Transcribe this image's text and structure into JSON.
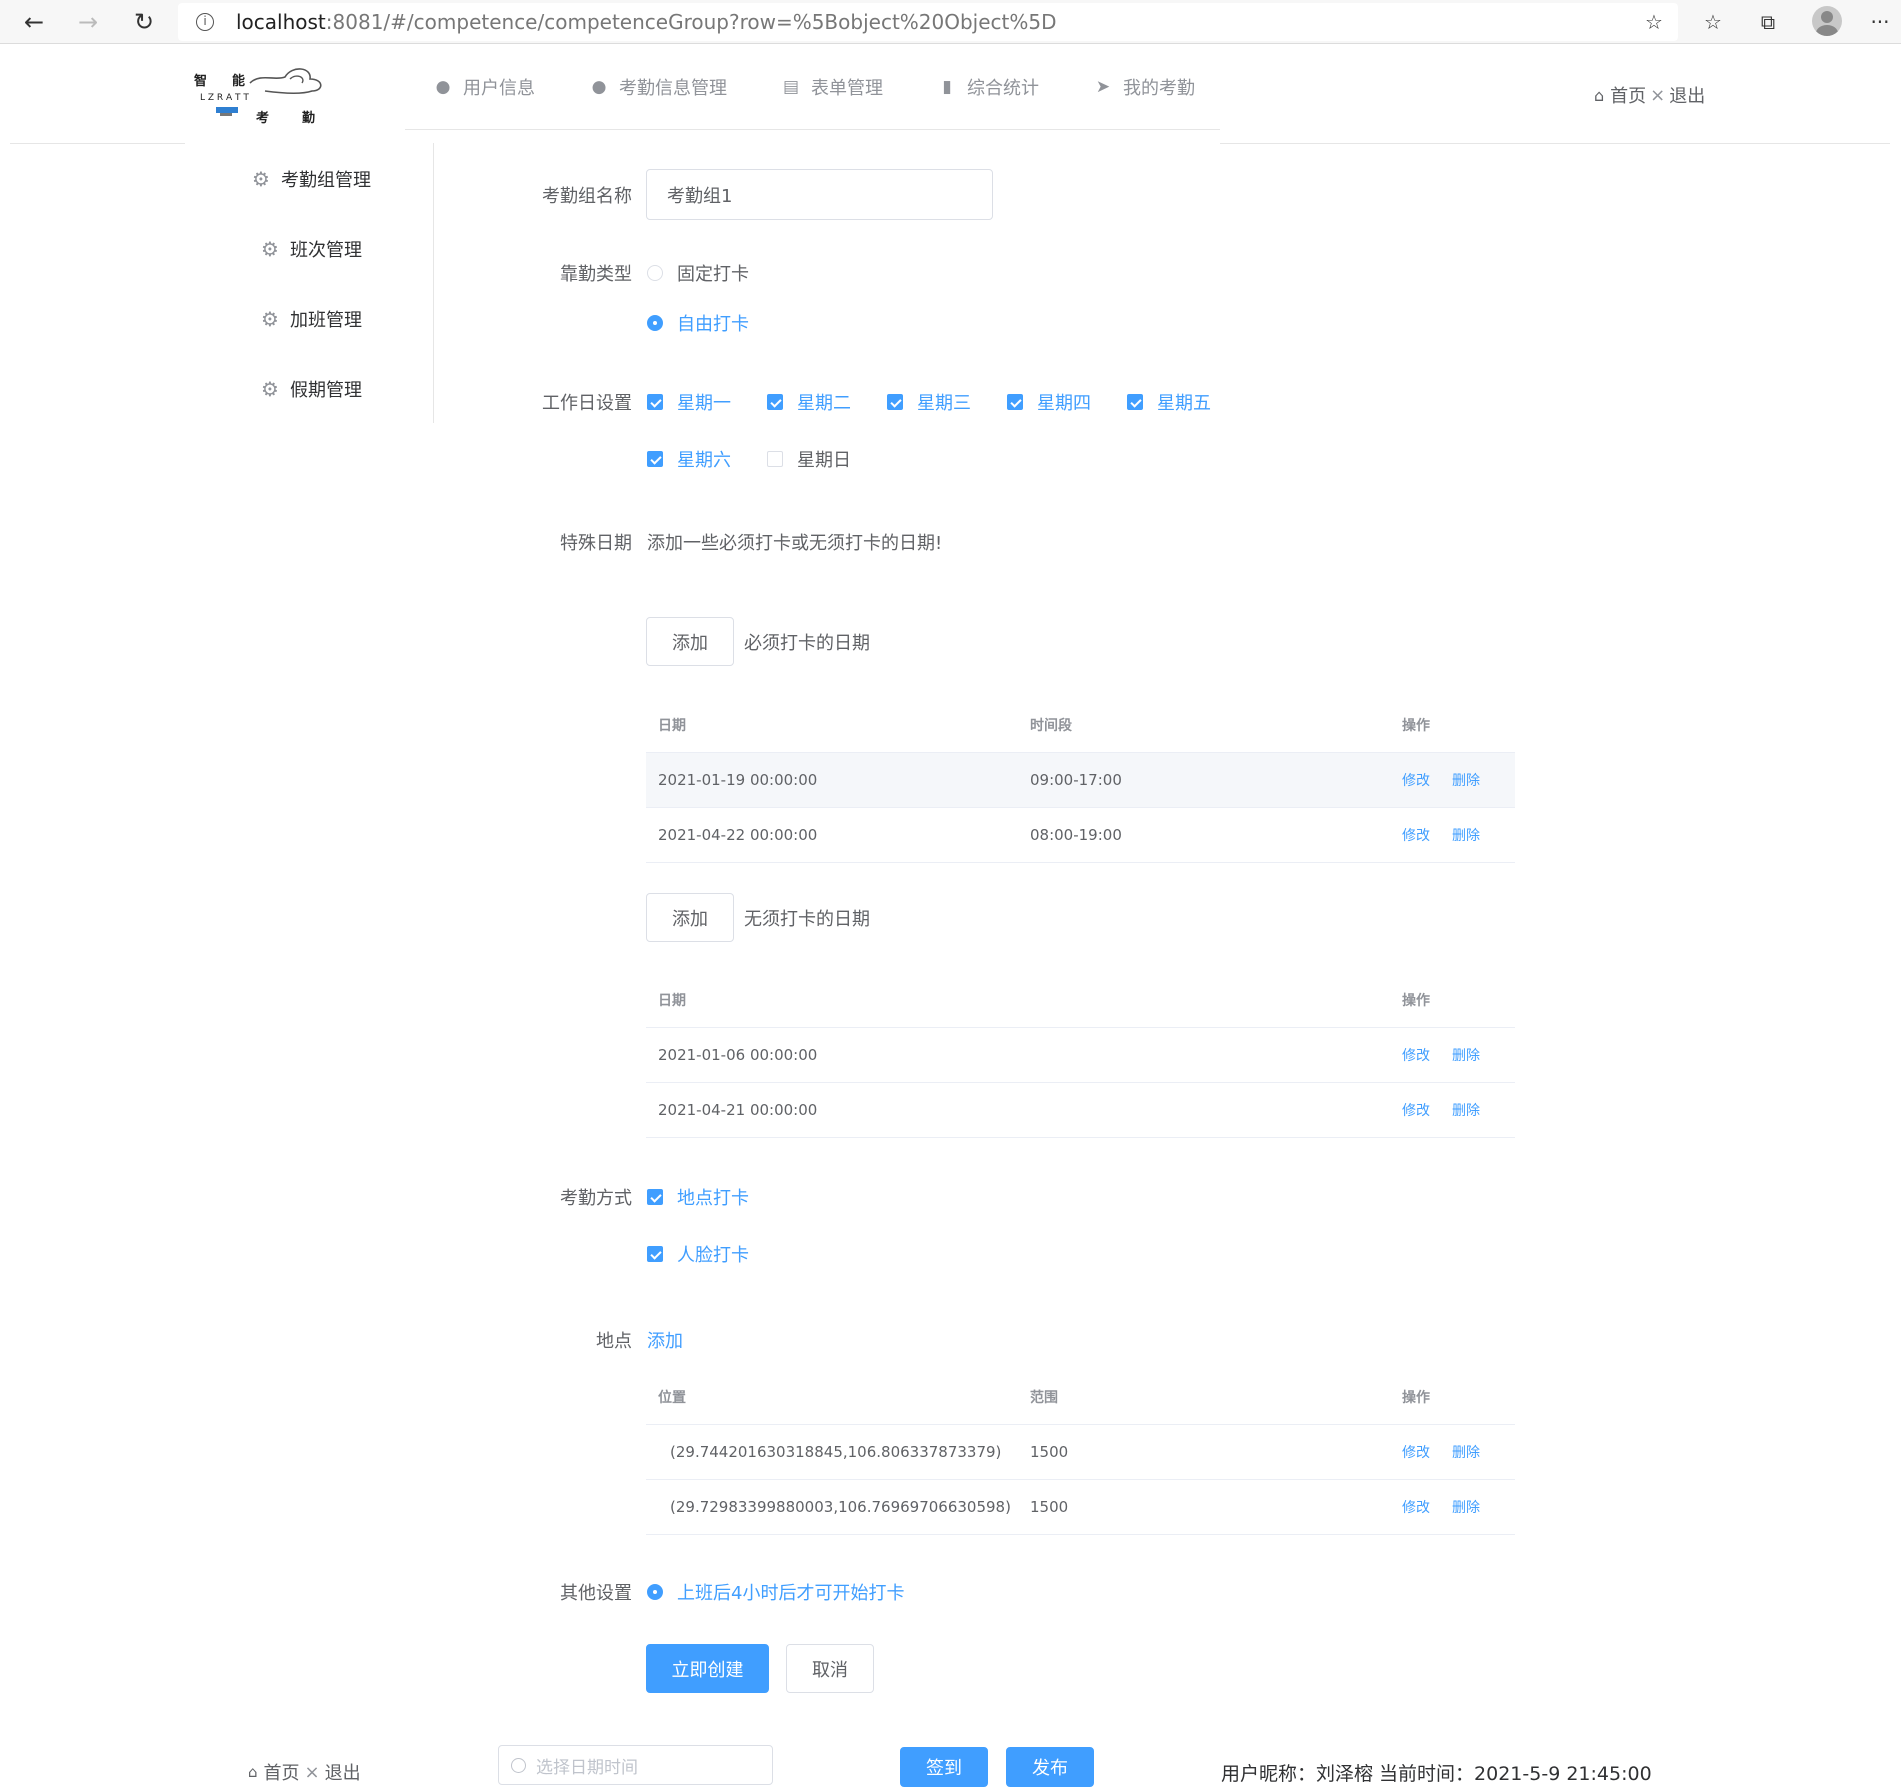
{
  "browser": {
    "url_host": "localhost",
    "url_rest": ":8081/#/competence/competenceGroup?row=%5Bobject%20Object%5D"
  },
  "nav": {
    "items": [
      {
        "label": "用户信息",
        "icon": "user-icon"
      },
      {
        "label": "考勤信息管理",
        "icon": "user-manage-icon"
      },
      {
        "label": "表单管理",
        "icon": "form-icon"
      },
      {
        "label": "综合统计",
        "icon": "chart-icon"
      },
      {
        "label": "我的考勤",
        "icon": "send-icon"
      }
    ],
    "home": "首页",
    "logout": "退出"
  },
  "sidebar": {
    "items": [
      {
        "label": "考勤组管理"
      },
      {
        "label": "班次管理"
      },
      {
        "label": "加班管理"
      },
      {
        "label": "假期管理"
      }
    ]
  },
  "form": {
    "name_label": "考勤组名称",
    "name_value": "考勤组1",
    "type_label": "靠勤类型",
    "type_options": [
      {
        "label": "固定打卡",
        "selected": false
      },
      {
        "label": "自由打卡",
        "selected": true
      }
    ],
    "workday_label": "工作日设置",
    "workdays": [
      {
        "label": "星期一",
        "checked": true
      },
      {
        "label": "星期二",
        "checked": true
      },
      {
        "label": "星期三",
        "checked": true
      },
      {
        "label": "星期四",
        "checked": true
      },
      {
        "label": "星期五",
        "checked": true
      },
      {
        "label": "星期六",
        "checked": true
      },
      {
        "label": "星期日",
        "checked": false
      }
    ],
    "special_label": "特殊日期",
    "special_hint": "添加一些必须打卡或无须打卡的日期!",
    "add_label": "添加",
    "must_title": "必须打卡的日期",
    "must_table": {
      "headers": [
        "日期",
        "时间段",
        "操作"
      ],
      "rows": [
        {
          "date": "2021-01-19 00:00:00",
          "time": "09:00-17:00"
        },
        {
          "date": "2021-04-22 00:00:00",
          "time": "08:00-19:00"
        }
      ]
    },
    "free_title": "无须打卡的日期",
    "free_table": {
      "headers": [
        "日期",
        "操作"
      ],
      "rows": [
        {
          "date": "2021-01-06 00:00:00"
        },
        {
          "date": "2021-04-21 00:00:00"
        }
      ]
    },
    "edit_label": "修改",
    "delete_label": "删除",
    "method_label": "考勤方式",
    "methods": [
      {
        "label": "地点打卡",
        "checked": true
      },
      {
        "label": "人脸打卡",
        "checked": true
      }
    ],
    "location_label": "地点",
    "location_add": "添加",
    "location_table": {
      "headers": [
        "位置",
        "范围",
        "操作"
      ],
      "rows": [
        {
          "pos": "(29.744201630318845,106.806337873379)",
          "range": "1500"
        },
        {
          "pos": "(29.72983399880003,106.76969706630598)",
          "range": "1500"
        }
      ]
    },
    "other_label": "其他设置",
    "other_option": "上班后4小时后才可开始打卡",
    "submit": "立即创建",
    "cancel": "取消"
  },
  "footer": {
    "home": "首页",
    "logout": "退出",
    "picker_placeholder": "选择日期时间",
    "signin": "签到",
    "publish": "发布",
    "user_info": "用户昵称：刘泽榕 当前时间：2021-5-9 21:45:00"
  },
  "colors": {
    "primary": "#409eff",
    "text": "#606266",
    "muted": "#909399",
    "border": "#dcdfe6"
  }
}
